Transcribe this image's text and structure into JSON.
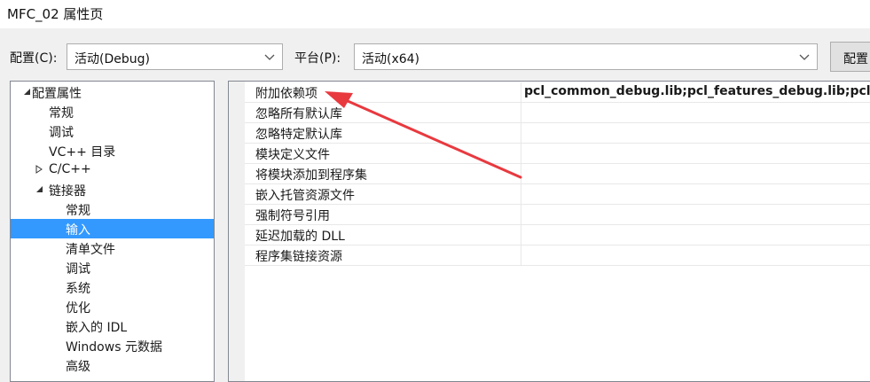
{
  "window": {
    "title": "MFC_02 属性页"
  },
  "toolbar": {
    "config_label": "配置(C):",
    "config_value": "活动(Debug)",
    "platform_label": "平台(P):",
    "platform_value": "活动(x64)",
    "config_manager_button": "配置"
  },
  "tree": {
    "items": [
      {
        "label": "配置属性",
        "expander": "expanded"
      },
      {
        "label": "常规"
      },
      {
        "label": "调试"
      },
      {
        "label": "VC++ 目录"
      },
      {
        "label": "C/C++",
        "expander": "collapsed"
      },
      {
        "label": "链接器",
        "expander": "expanded"
      },
      {
        "label": "常规"
      },
      {
        "label": "输入",
        "selected": true
      },
      {
        "label": "清单文件"
      },
      {
        "label": "调试"
      },
      {
        "label": "系统"
      },
      {
        "label": "优化"
      },
      {
        "label": "嵌入的 IDL"
      },
      {
        "label": "Windows 元数据"
      },
      {
        "label": "高级"
      }
    ]
  },
  "properties": {
    "rows": [
      {
        "name": "附加依赖项",
        "value": "pcl_common_debug.lib;pcl_features_debug.lib;pcl_fi"
      },
      {
        "name": "忽略所有默认库",
        "value": ""
      },
      {
        "name": "忽略特定默认库",
        "value": ""
      },
      {
        "name": "模块定义文件",
        "value": ""
      },
      {
        "name": "将模块添加到程序集",
        "value": ""
      },
      {
        "name": "嵌入托管资源文件",
        "value": ""
      },
      {
        "name": "强制符号引用",
        "value": ""
      },
      {
        "name": "延迟加载的 DLL",
        "value": ""
      },
      {
        "name": "程序集链接资源",
        "value": ""
      }
    ]
  },
  "colors": {
    "selection": "#3399ff",
    "annotation_arrow": "#e8393f"
  },
  "icons": {
    "combo_dropdown": "chevron-down-icon",
    "tree_expanded": "triangle-expanded-icon",
    "tree_collapsed": "triangle-collapsed-icon"
  }
}
